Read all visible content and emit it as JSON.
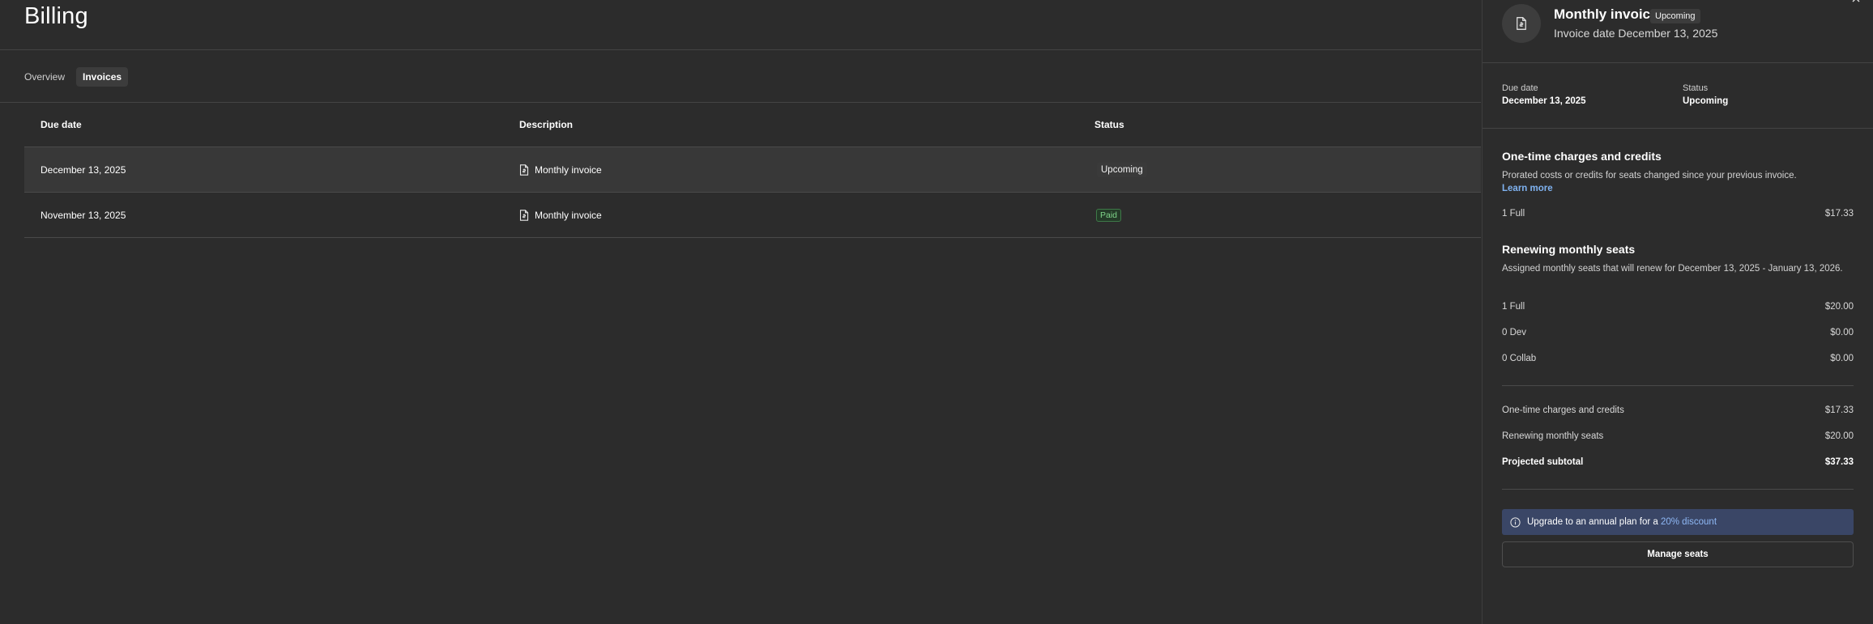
{
  "page": {
    "title": "Billing"
  },
  "tabs": [
    {
      "label": "Overview",
      "active": false
    },
    {
      "label": "Invoices",
      "active": true
    }
  ],
  "table": {
    "headers": {
      "due_date": "Due date",
      "description": "Description",
      "status": "Status"
    },
    "rows": [
      {
        "due_date": "December 13, 2025",
        "description": "Monthly invoice",
        "status": "Upcoming",
        "selected": true
      },
      {
        "due_date": "November 13, 2025",
        "description": "Monthly invoice",
        "status": "Paid",
        "selected": false
      }
    ]
  },
  "panel": {
    "title": "Monthly invoice",
    "badge": "Upcoming",
    "subtitle": "Invoice date December 13, 2025",
    "due_date_label": "Due date",
    "due_date_value": "December 13, 2025",
    "status_label": "Status",
    "status_value": "Upcoming",
    "one_time": {
      "title": "One-time charges and credits",
      "desc": "Prorated costs or credits for seats changed since your previous invoice.",
      "learn_more": "Learn more",
      "items": [
        {
          "label": "1 Full",
          "amount": "$17.33"
        }
      ]
    },
    "renewing": {
      "title": "Renewing monthly seats",
      "desc": "Assigned monthly seats that will renew for December 13, 2025 - January 13, 2026.",
      "items": [
        {
          "label": "1 Full",
          "amount": "$20.00"
        },
        {
          "label": "0 Dev",
          "amount": "$0.00"
        },
        {
          "label": "0 Collab",
          "amount": "$0.00"
        }
      ]
    },
    "summary": [
      {
        "label": "One-time charges and credits",
        "amount": "$17.33"
      },
      {
        "label": "Renewing monthly seats",
        "amount": "$20.00"
      }
    ],
    "subtotal": {
      "label": "Projected subtotal",
      "amount": "$37.33"
    },
    "upgrade": {
      "text": "Upgrade to an annual plan for a",
      "link": "20% discount"
    },
    "manage_button": "Manage seats"
  },
  "colors": {
    "background": "#2c2c2c",
    "accent_link": "#7fb2f0",
    "upgrade_bg": "#3a4666",
    "paid_green": "#7fd48a"
  },
  "icons": [
    "file-invoice-icon",
    "close-icon",
    "info-icon"
  ]
}
